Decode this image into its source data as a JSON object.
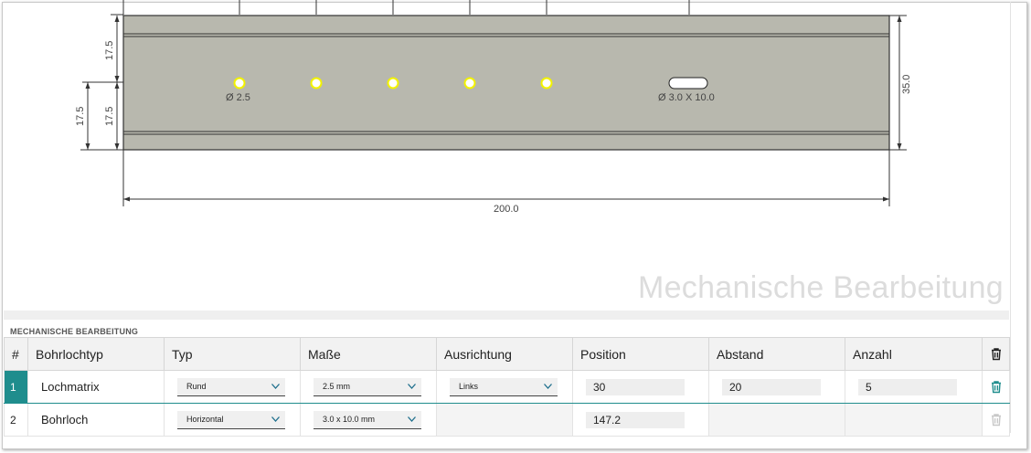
{
  "drawing": {
    "dim_top": "17.5",
    "dim_mid": "17.5",
    "dim_left": "17.5",
    "dim_right": "35.0",
    "dim_width": "200.0",
    "hole_round_label": "Ø 2.5",
    "hole_slot_label": "Ø 3.0 X 10.0",
    "colors": {
      "rail": "#b8b8ae",
      "hole": "#f2f200",
      "line": "#333333"
    }
  },
  "watermark": "Mechanische Bearbeitung",
  "section_title": "MECHANISCHE BEARBEITUNG",
  "table": {
    "headers": {
      "index": "#",
      "bohrlochtyp": "Bohrlochtyp",
      "typ": "Typ",
      "masse": "Maße",
      "ausrichtung": "Ausrichtung",
      "position": "Position",
      "abstand": "Abstand",
      "anzahl": "Anzahl"
    },
    "rows": [
      {
        "index": "1",
        "bohrlochtyp": "Lochmatrix",
        "typ": "Rund",
        "masse": "2.5 mm",
        "ausrichtung": "Links",
        "position": "30",
        "abstand": "20",
        "anzahl": "5",
        "selected": true
      },
      {
        "index": "2",
        "bohrlochtyp": "Bohrloch",
        "typ": "Horizontal",
        "masse": "3.0 x 10.0 mm",
        "position": "147.2",
        "selected": false
      }
    ]
  },
  "accent_color": "#1f8d8d"
}
